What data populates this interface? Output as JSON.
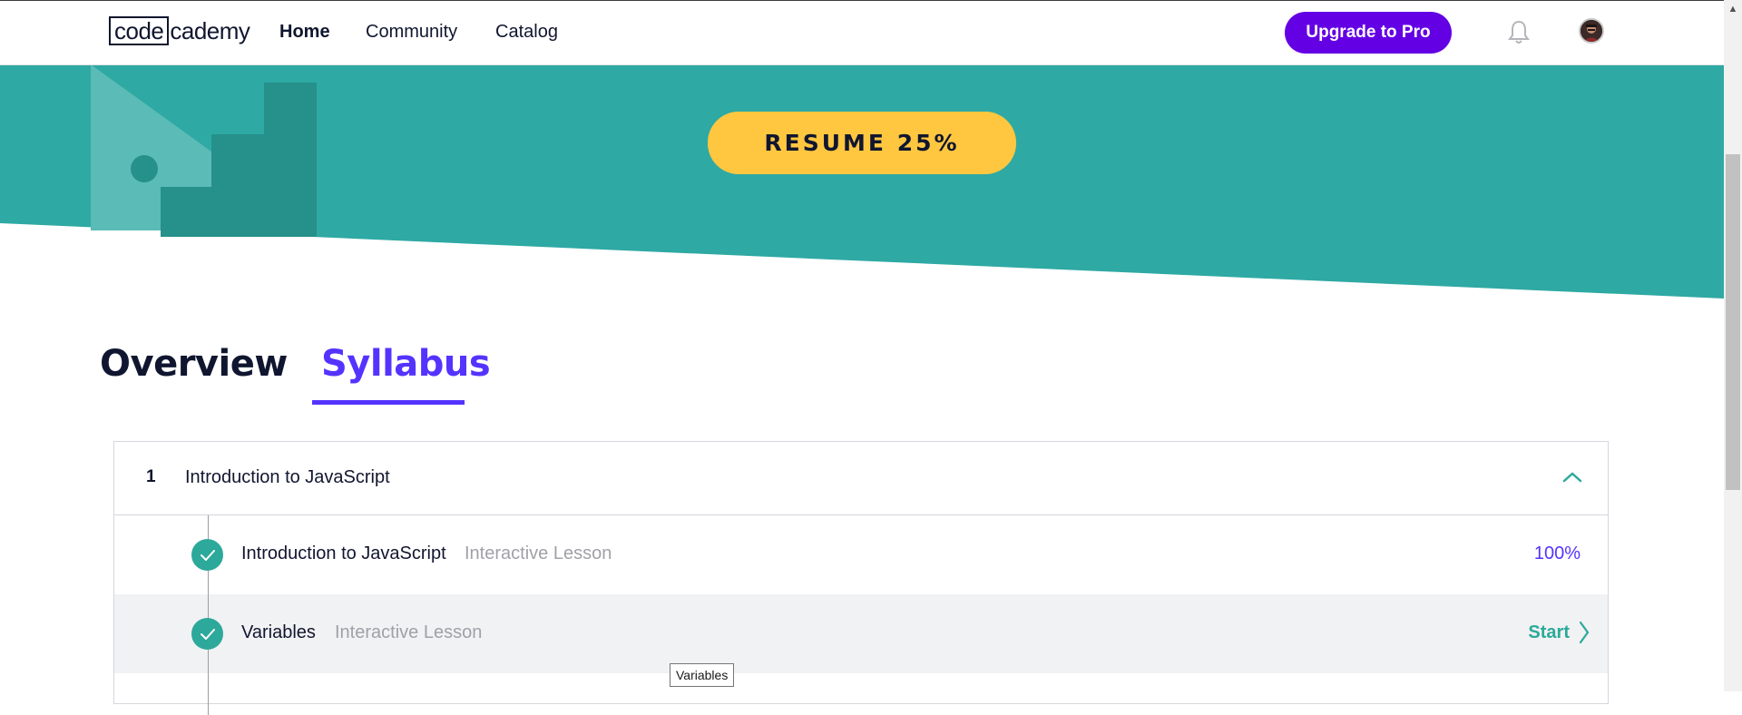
{
  "header": {
    "logo_code": "code",
    "logo_rest": "cademy",
    "nav": [
      "Home",
      "Community",
      "Catalog"
    ],
    "upgrade_label": "Upgrade to Pro",
    "bell_icon": "bell-icon",
    "avatar_icon": "user-avatar"
  },
  "hero": {
    "resume_label": "RESUME 25%",
    "colors": {
      "teal": "#2ea9a4",
      "dark_teal": "#26908b",
      "light_teal": "#5bbbb6"
    }
  },
  "tabs": {
    "overview": "Overview",
    "syllabus": "Syllabus",
    "active": "Syllabus"
  },
  "syllabus": {
    "module": {
      "number": "1",
      "title": "Introduction to JavaScript",
      "toggle_icon": "chevron-up-icon"
    },
    "lessons": [
      {
        "name": "Introduction to JavaScript",
        "type": "Interactive Lesson",
        "status": "100%",
        "completed": true
      },
      {
        "name": "Variables",
        "type": "Interactive Lesson",
        "action": "Start",
        "completed": true
      }
    ]
  },
  "tooltip": {
    "text": "Variables"
  },
  "colors": {
    "brand_purple": "#6400e4",
    "accent_blue": "#5533ff",
    "yellow": "#ffc740",
    "green": "#2ca99a"
  }
}
